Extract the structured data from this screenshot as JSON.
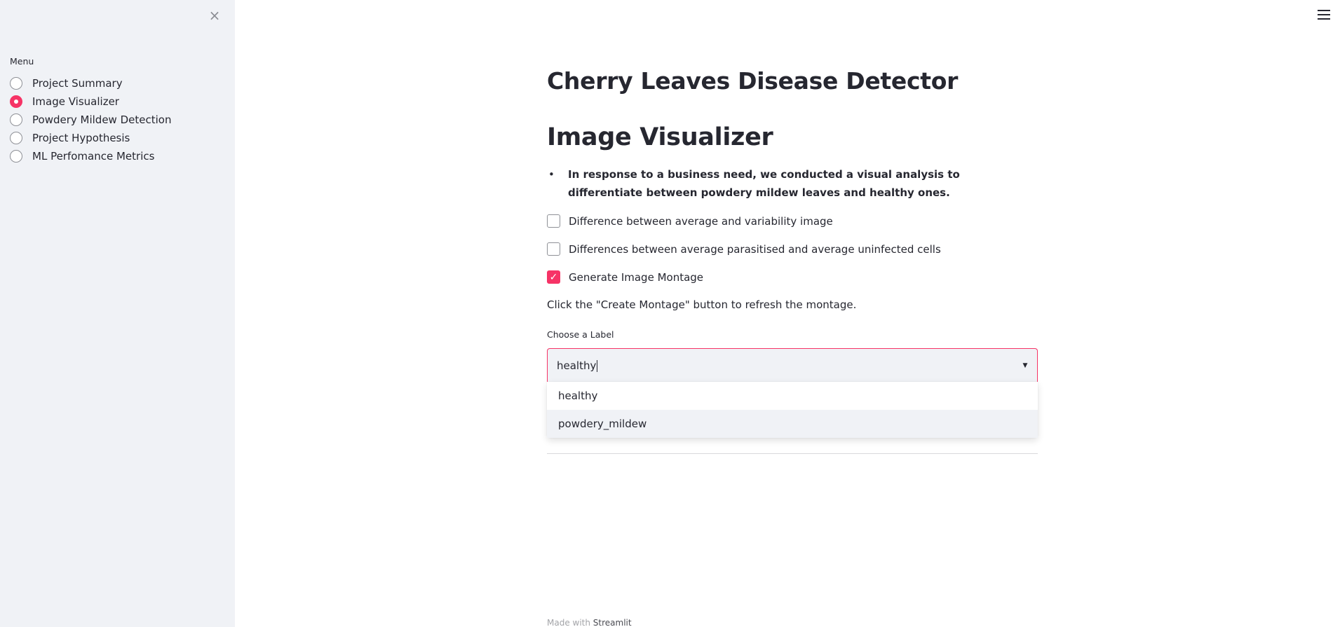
{
  "sidebar": {
    "close_icon": "×",
    "menu_label": "Menu",
    "items": [
      {
        "label": "Project Summary",
        "selected": false
      },
      {
        "label": "Image Visualizer",
        "selected": true
      },
      {
        "label": "Powdery Mildew Detection",
        "selected": false
      },
      {
        "label": "Project Hypothesis",
        "selected": false
      },
      {
        "label": "ML Perfomance Metrics",
        "selected": false
      }
    ]
  },
  "main": {
    "title": "Cherry Leaves Disease Detector",
    "subheader": "Image Visualizer",
    "bullet_marker": "•",
    "bullet_text": "In response to a business need, we conducted a visual analysis to differentiate between powdery mildew leaves and healthy ones.",
    "checkboxes": [
      {
        "label": "Difference between average and variability image",
        "checked": false
      },
      {
        "label": "Differences between average parasitised and average uninfected cells",
        "checked": false
      },
      {
        "label": "Generate Image Montage",
        "checked": true
      }
    ],
    "info_text": "Click the \"Create Montage\" button to refresh the montage.",
    "select": {
      "label": "Choose a Label",
      "value": "healthy",
      "options": [
        "healthy",
        "powdery_mildew"
      ],
      "highlighted_index": 1
    }
  },
  "footer": {
    "prefix": "Made with ",
    "brand": "Streamlit"
  },
  "colors": {
    "accent": "#f63366",
    "sidebar_bg": "#f0f2f6",
    "text": "#262730"
  },
  "icons": {
    "close": "close-icon",
    "menu": "hamburger-menu-icon",
    "dropdown": "chevron-down-icon",
    "check": "check-icon"
  }
}
